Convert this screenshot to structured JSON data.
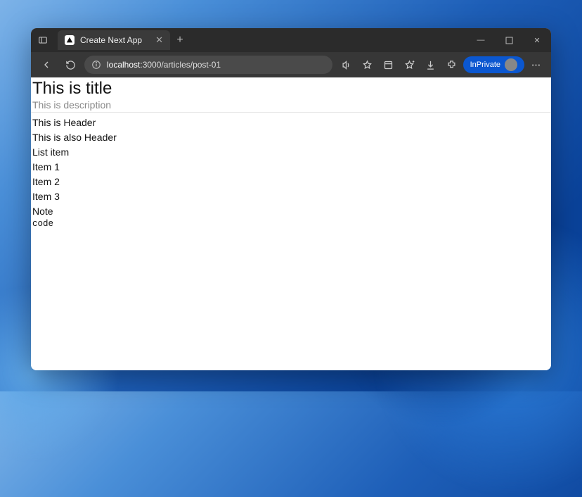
{
  "window": {
    "tab_title": "Create Next App",
    "new_tab_tooltip": "New tab",
    "minimize": "—",
    "maximize": "▢",
    "close": "✕"
  },
  "toolbar": {
    "back_icon": "arrow-left",
    "refresh_icon": "refresh",
    "site_info_icon": "info",
    "url_host": "localhost",
    "url_port_path": ":3000/articles/post-01",
    "inprivate_label": "InPrivate",
    "more_icon": "more"
  },
  "page": {
    "title": "This is title",
    "description": "This is description",
    "lines": [
      "This is Header",
      "This is also Header",
      "List item",
      "Item 1",
      "Item 2",
      "Item 3",
      "Note"
    ],
    "code": "code"
  }
}
